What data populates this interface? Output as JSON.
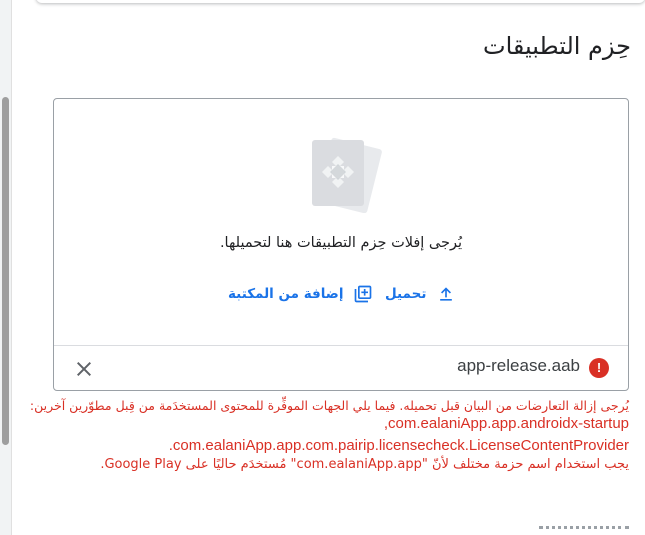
{
  "section": {
    "title": "حِزم التطبيقات"
  },
  "upload_box": {
    "illustration_icon": "app-bundle-document-icon",
    "drop_hint": "يُرجى إفلات حِزم التطبيقات هنا لتحميلها.",
    "upload_label": "تحميل",
    "upload_icon": "upload-icon",
    "library_label": "إضافة من المكتبة",
    "library_icon": "add-to-library-icon"
  },
  "file": {
    "name": "app-release.aab",
    "status_icon": "error-icon",
    "status_symbol": "!",
    "remove_icon": "close-icon"
  },
  "error": {
    "line1": "يُرجى إزالة التعارضات من البيان قبل تحميله. فيما يلي الجهات الموفِّرة للمحتوى المستخدَمة من قِبل مطوّرين آخرين:",
    "line2": "com.ealaniApp.app.androidx-startup,",
    "line3": "com.ealaniApp.app.com.pairip.licensecheck.LicenseContentProvider.",
    "line4": "يجب استخدام اسم حزمة مختلف لأنّ \"com.ealaniApp.app\" مُستخدَم حاليًا على Google Play."
  },
  "colors": {
    "accent": "#1a73e8",
    "error": "#d93025",
    "border": "#9aa0a6"
  }
}
